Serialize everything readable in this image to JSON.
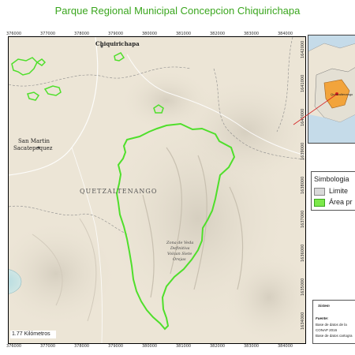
{
  "title": "Parque Regional Municipal Concepcion Chiquirichapa",
  "x_ticks": [
    "376000",
    "377000",
    "378000",
    "379000",
    "380000",
    "381000",
    "382000",
    "383000",
    "384000"
  ],
  "y_ticks": [
    "1642000",
    "1641000",
    "1640000",
    "1639000",
    "1638000",
    "1637000",
    "1636000",
    "1635000",
    "1634000"
  ],
  "places": {
    "chiquirichapa": "Chiquirichapa",
    "san_martin_line1": "San Martin",
    "san_martin_line2": "Sacatepequez",
    "department": "QUETZALTENANGO",
    "zona_line1": "Zona de Veda",
    "zona_line2": "Definitiva",
    "zona_line3": "Volcan Siete",
    "zona_line4": "Orejas"
  },
  "scale_bar": {
    "label": "1.77 Kilómetros"
  },
  "inset": {
    "label": "Quetzaltenango"
  },
  "legend": {
    "title": "Simbologia",
    "items": [
      {
        "label": "Limite",
        "color": "#d9d9d9"
      },
      {
        "label": "Área pr",
        "color": "#7ce84a"
      }
    ]
  },
  "info": {
    "heading": "Sistem",
    "source_label": "Fuente:",
    "line1": "Base de datos de la",
    "line2": "CONAP 2016",
    "line3": "Base de datos cartogra"
  },
  "colors": {
    "protected_area": "#4fdf2b",
    "title": "#3aa61e",
    "terrain": "#ece5d6"
  }
}
